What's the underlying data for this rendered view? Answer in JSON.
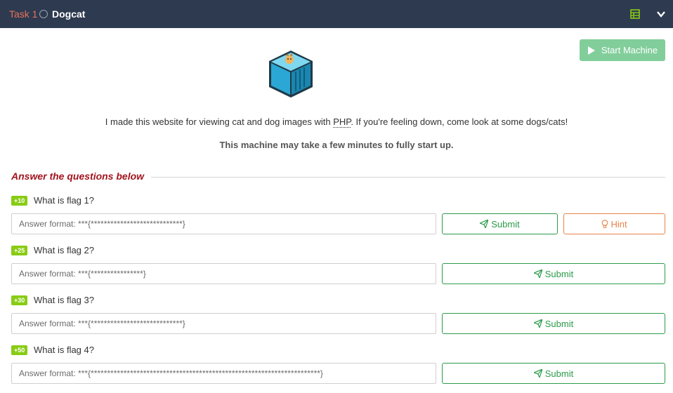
{
  "header": {
    "task_number": "Task 1",
    "task_title": "Dogcat"
  },
  "start_machine": {
    "label": "Start Machine"
  },
  "description": {
    "text_before": "I made this website for viewing cat and dog images with ",
    "abbr": "PHP",
    "text_after": ". If you're feeling down, come look at some dogs/cats!",
    "note": "This machine may take a few minutes to fully start up."
  },
  "questions_heading": "Answer the questions below",
  "questions": [
    {
      "points": "+10",
      "text": "What is flag 1?",
      "placeholder": "Answer format: ***{****************************}",
      "submit_label": "Submit",
      "hint_label": "Hint"
    },
    {
      "points": "+25",
      "text": "What is flag 2?",
      "placeholder": "Answer format: ***{****************}",
      "submit_label": "Submit"
    },
    {
      "points": "+30",
      "text": "What is flag 3?",
      "placeholder": "Answer format: ***{****************************}",
      "submit_label": "Submit"
    },
    {
      "points": "+50",
      "text": "What is flag 4?",
      "placeholder": "Answer format: ***{**********************************************************************}",
      "submit_label": "Submit"
    }
  ],
  "colors": {
    "header_bg": "#2e3a4f",
    "task_number": "#e8735a",
    "start_button": "#82ce9b",
    "heading": "#a2141e",
    "points_badge": "#88cc14",
    "submit": "#2c9b4a",
    "hint": "#e8844a"
  },
  "icons": [
    "notes-icon",
    "chevron-down-icon",
    "play-icon",
    "paper-plane-icon",
    "lightbulb-icon",
    "container-logo"
  ]
}
